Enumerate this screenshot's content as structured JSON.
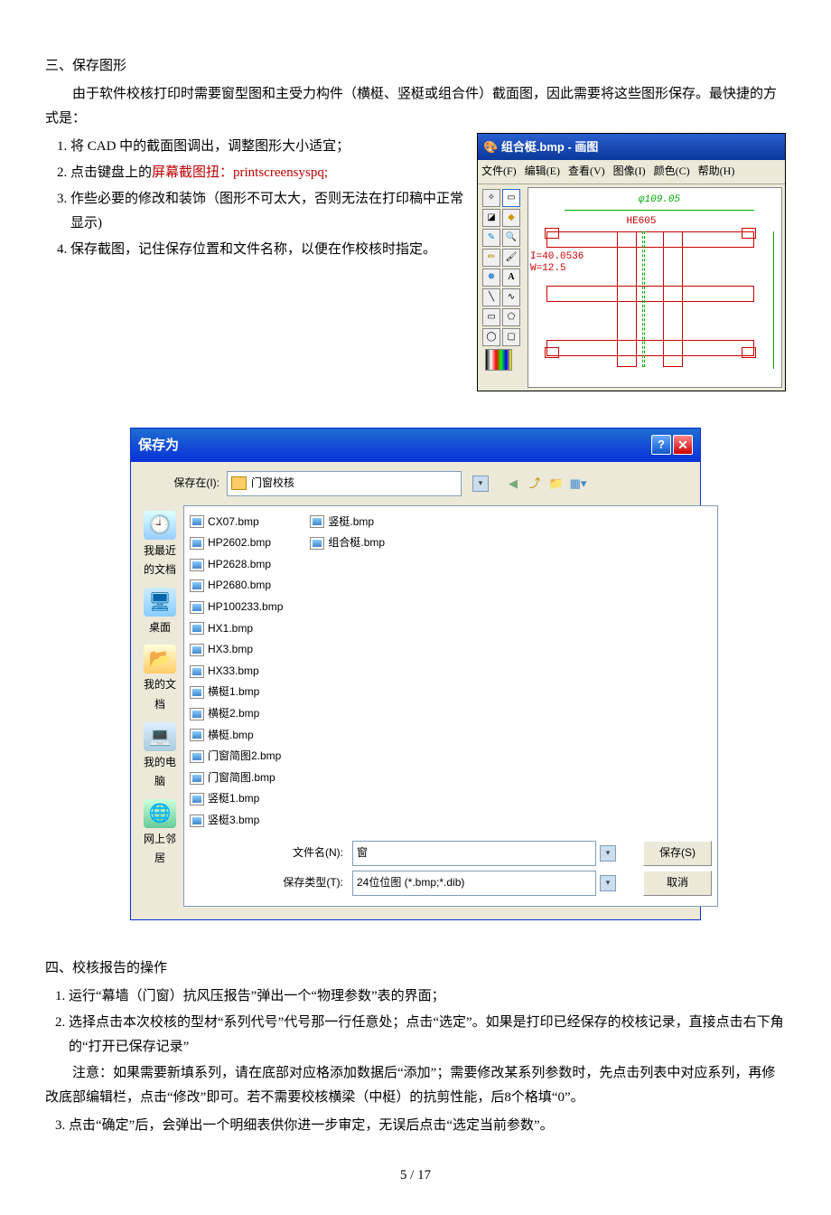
{
  "sec3": {
    "title": "三、保存图形",
    "intro": "由于软件校核打印时需要窗型图和主受力构件（横梃、竖梃或组合件）截面图，因此需要将这些图形保存。最快捷的方式是：",
    "steps": [
      "将 CAD 中的截面图调出，调整图形大小适宜；",
      "点击键盘上的",
      "屏幕截图扭：printscreensyspq;",
      "作些必要的修改和装饰（图形不可太大，否则无法在打印稿中正常显示)",
      "保存截图，记住保存位置和文件名称，以便在作校核时指定。"
    ]
  },
  "paint": {
    "title": "组合梃.bmp - 画图",
    "menu": [
      "文件(F)",
      "编辑(E)",
      "查看(V)",
      "图像(I)",
      "颜色(C)",
      "帮助(H)"
    ],
    "he": "HE605",
    "dim": "φ109.05",
    "i": "I=40.0536",
    "w": "W=12.5"
  },
  "save": {
    "title": "保存为",
    "savein_lbl": "保存在(I):",
    "savein_val": "门窗校核",
    "places": [
      "我最近的文档",
      "桌面",
      "我的文档",
      "我的电脑",
      "网上邻居"
    ],
    "files_col1": [
      "CX07.bmp",
      "HP2602.bmp",
      "HP2628.bmp",
      "HP2680.bmp",
      "HP100233.bmp",
      "HX1.bmp",
      "HX3.bmp",
      "HX33.bmp",
      "横梃1.bmp",
      "横梃2.bmp",
      "横梃.bmp",
      "门窗简图2.bmp",
      "门窗简图.bmp",
      "竖梃1.bmp",
      "竖梃3.bmp"
    ],
    "files_col2": [
      "竖梃.bmp",
      "组合梃.bmp"
    ],
    "fname_lbl": "文件名(N):",
    "fname_val": "窗",
    "ftype_lbl": "保存类型(T):",
    "ftype_val": "24位位图 (*.bmp;*.dib)",
    "btn_save": "保存(S)",
    "btn_cancel": "取消"
  },
  "sec4": {
    "title": "四、校核报告的操作",
    "i1": "运行“幕墙（门窗）抗风压报告”弹出一个“物理参数”表的界面；",
    "i2": "选择点击本次校核的型材“系列代号”代号那一行任意处；点击“选定”。如果是打印已经保存的校核记录，直接点击右下角的“打开已保存记录”",
    "note": "注意：如果需要新填系列，请在底部对应格添加数据后“添加”；需要修改某系列参数时，先点击列表中对应系列，再修改底部编辑栏，点击“修改”即可。若不需要校核横梁（中梃）的抗剪性能，后8个格填“0”。",
    "i3": "点击“确定”后，会弹出一个明细表供你进一步审定，无误后点击“选定当前参数”。"
  },
  "pagenum": "5 / 17"
}
